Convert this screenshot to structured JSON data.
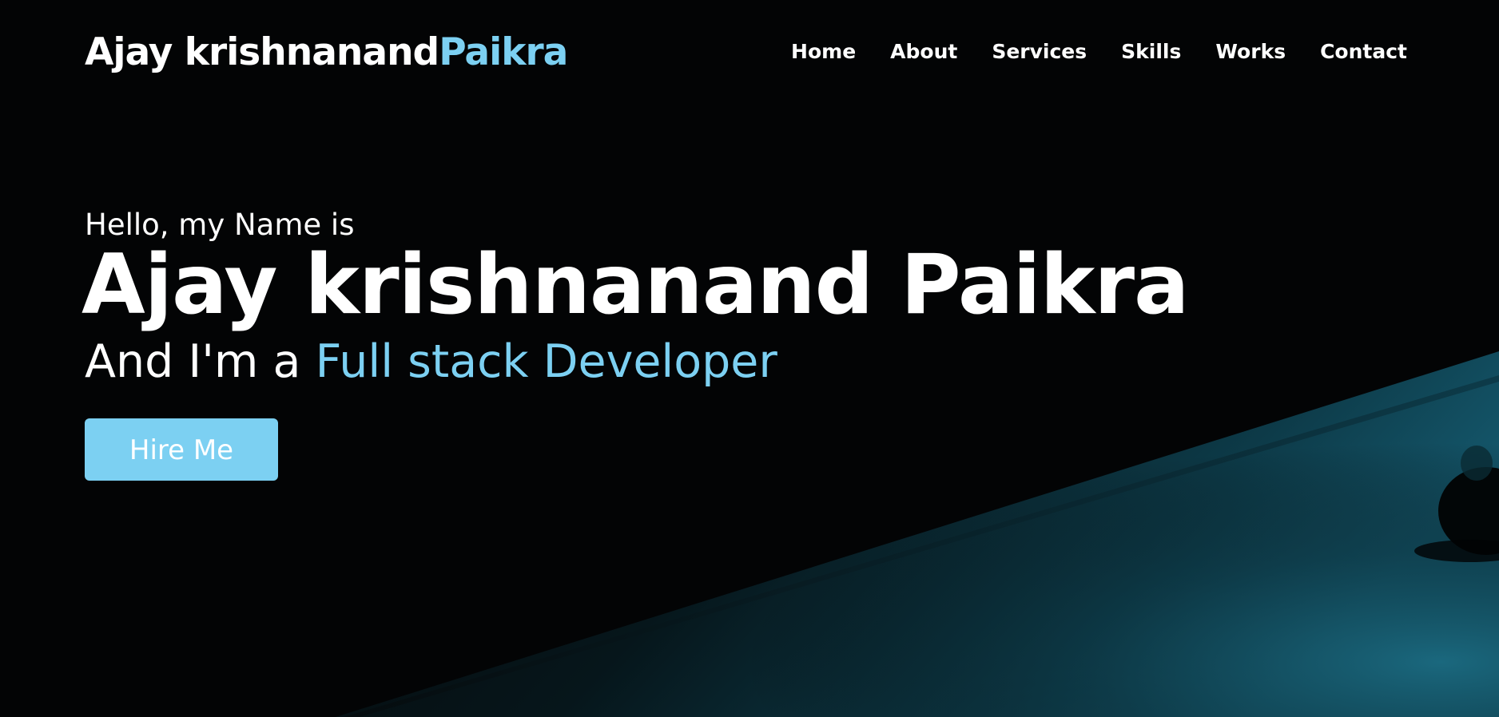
{
  "logo": {
    "first": "Ajay krishnanand",
    "accent": "Paikra"
  },
  "nav": {
    "items": [
      {
        "label": "Home"
      },
      {
        "label": "About"
      },
      {
        "label": "Services"
      },
      {
        "label": "Skills"
      },
      {
        "label": "Works"
      },
      {
        "label": "Contact"
      }
    ]
  },
  "hero": {
    "greeting": "Hello, my Name is",
    "name": "Ajay krishnanand Paikra",
    "role_prefix": "And I'm a ",
    "role_accent": "Full stack Developer",
    "cta_label": "Hire Me"
  },
  "colors": {
    "accent": "#7cd0f2",
    "background": "#030405",
    "text": "#ffffff",
    "backdrop_glow": "#0d4a5c"
  }
}
